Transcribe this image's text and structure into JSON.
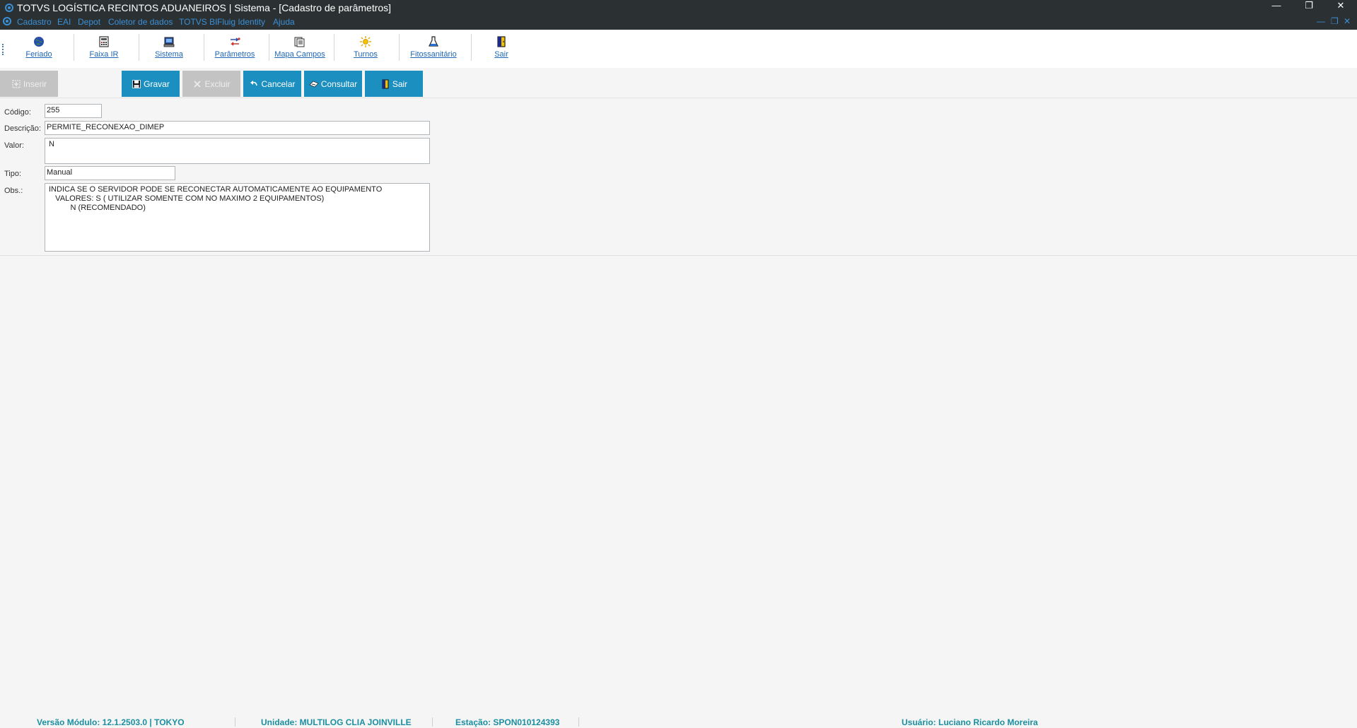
{
  "window": {
    "title": "TOTVS LOGÍSTICA RECINTOS ADUANEIROS | Sistema - [Cadastro de parâmetros]",
    "minimize": "—",
    "restore": "❐",
    "close": "✕"
  },
  "menu": {
    "items": [
      "Cadastro",
      "EAI",
      "Depot",
      "Coletor de dados",
      "TOTVS BI",
      "Fluig Identity",
      "Ajuda"
    ],
    "mdi_minimize": "—",
    "mdi_restore": "❐",
    "mdi_close": "✕"
  },
  "toolbar": {
    "items": [
      {
        "label": "Feriado",
        "icon": "globe-icon"
      },
      {
        "label": "Faixa IR",
        "icon": "calculator-icon"
      },
      {
        "label": "Sistema",
        "icon": "computer-icon"
      },
      {
        "label": "Parâmetros",
        "icon": "parameters-icon"
      },
      {
        "label": "Mapa Campos",
        "icon": "map-fields-icon"
      },
      {
        "label": "Turnos",
        "icon": "sun-icon"
      },
      {
        "label": "Fitossanitário",
        "icon": "flask-icon"
      },
      {
        "label": "Sair",
        "icon": "exit-door-icon"
      }
    ]
  },
  "actions": {
    "inserir": "Inserir",
    "gravar": "Gravar",
    "excluir": "Excluir",
    "cancelar": "Cancelar",
    "consultar": "Consultar",
    "sair": "Sair"
  },
  "colors": {
    "active_button": "#1a8fc0",
    "disabled_button": "#c3c3c3",
    "title_bar": "#2b3133",
    "link_blue": "#1f66b3",
    "status_text": "#1a8fa0"
  },
  "form": {
    "codigo_label": "Código:",
    "codigo_value": "255",
    "descricao_label": "Descrição:",
    "descricao_value": "PERMITE_RECONEXAO_DIMEP",
    "valor_label": "Valor:",
    "valor_value": "N",
    "tipo_label": "Tipo:",
    "tipo_value": "Manual",
    "obs_label": "Obs.:",
    "obs_value": "INDICA SE O SERVIDOR PODE SE RECONECTAR AUTOMATICAMENTE AO EQUIPAMENTO\n   VALORES: S ( UTILIZAR SOMENTE COM NO MAXIMO 2 EQUIPAMENTOS)\n          N (RECOMENDADO)"
  },
  "status": {
    "versao": "Versão Módulo:  12.1.2503.0  |  TOKYO",
    "unidade": "Unidade: MULTILOG CLIA JOINVILLE",
    "estacao": "Estação: SPON010124393",
    "usuario": "Usuário: Luciano Ricardo Moreira"
  }
}
